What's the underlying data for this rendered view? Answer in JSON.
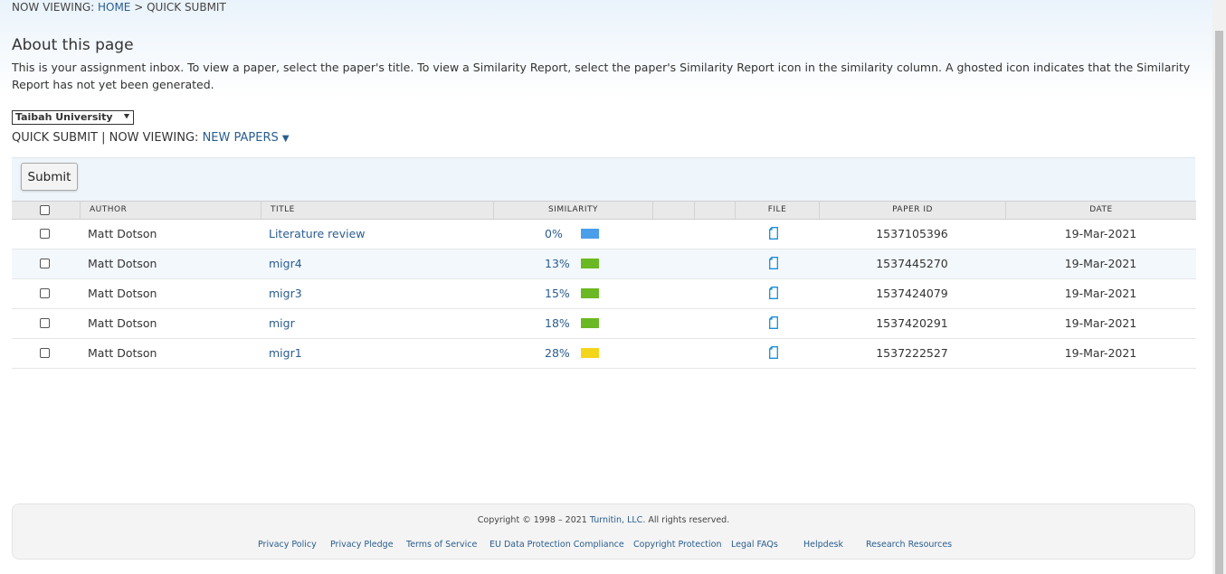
{
  "breadcrumb": {
    "prefix": "NOW VIEWING:",
    "home": "HOME",
    "separator": ">",
    "current": "QUICK SUBMIT"
  },
  "about": {
    "title": "About this page",
    "description": "This is your assignment inbox. To view a paper, select the paper's title. To view a Similarity Report, select the paper's Similarity Report icon in the similarity column. A ghosted icon indicates that the Similarity Report has not yet been generated."
  },
  "institution_select": {
    "value": "Taibah University",
    "arrow": "⯆"
  },
  "viewbar": {
    "quick_submit": "QUICK SUBMIT",
    "divider": "|",
    "now_viewing": "NOW VIEWING:",
    "filter": "NEW PAPERS",
    "filter_icon": "▼"
  },
  "toolbar": {
    "submit_label": "Submit"
  },
  "table": {
    "headers": {
      "author": "AUTHOR",
      "title": "TITLE",
      "similarity": "SIMILARITY",
      "file": "FILE",
      "paper_id": "PAPER ID",
      "date": "DATE"
    },
    "rows": [
      {
        "author": "Matt Dotson",
        "title": "Literature review",
        "similarity": "0%",
        "bar_color": "#4a9eea",
        "paper_id": "1537105396",
        "date": "19-Mar-2021"
      },
      {
        "author": "Matt Dotson",
        "title": "migr4",
        "similarity": "13%",
        "bar_color": "#6ab823",
        "paper_id": "1537445270",
        "date": "19-Mar-2021"
      },
      {
        "author": "Matt Dotson",
        "title": "migr3",
        "similarity": "15%",
        "bar_color": "#6ab823",
        "paper_id": "1537424079",
        "date": "19-Mar-2021"
      },
      {
        "author": "Matt Dotson",
        "title": "migr",
        "similarity": "18%",
        "bar_color": "#6ab823",
        "paper_id": "1537420291",
        "date": "19-Mar-2021"
      },
      {
        "author": "Matt Dotson",
        "title": "migr1",
        "similarity": "28%",
        "bar_color": "#f3d61c",
        "paper_id": "1537222527",
        "date": "19-Mar-2021"
      }
    ]
  },
  "footer": {
    "copyright_prefix": "Copyright © 1998 – 2021",
    "company": "Turnitin, LLC.",
    "copyright_suffix": "All rights reserved.",
    "links": [
      "Privacy Policy",
      "Privacy Pledge",
      "Terms of Service",
      "EU Data Protection Compliance",
      "Copyright Protection",
      "Legal FAQs",
      "Helpdesk",
      "Research Resources"
    ]
  },
  "colors": {
    "link": "#2a5d8f",
    "header_bg": "#e9e9e9",
    "alt_row": "#f3f8fd",
    "file_icon": "#1a8fd6"
  }
}
